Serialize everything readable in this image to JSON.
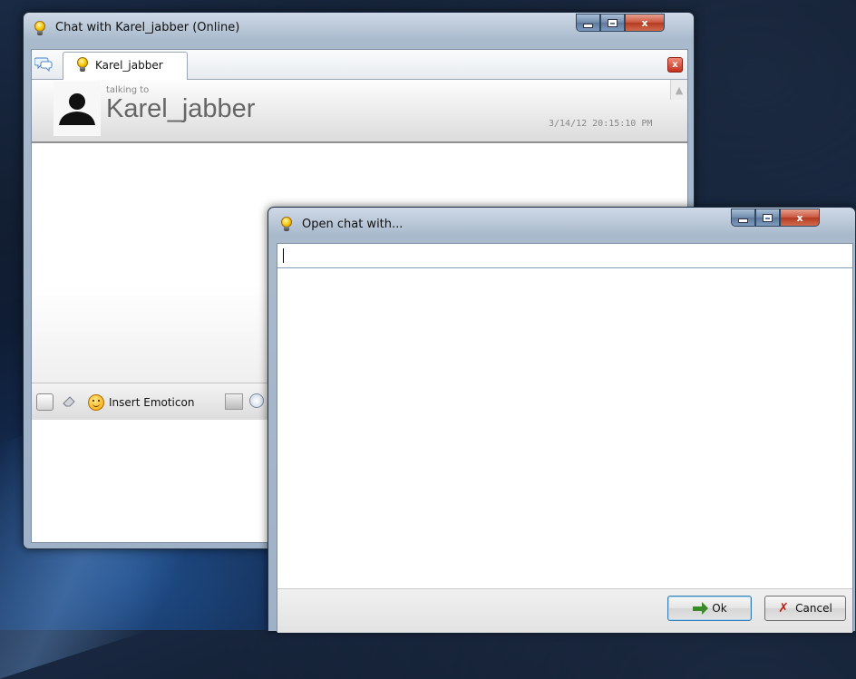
{
  "chat_window": {
    "title": "Chat with Karel_jabber (Online)",
    "tab_label": "Karel_jabber",
    "tab_close": "x",
    "talking_to": "talking to",
    "peer_name": "Karel_jabber",
    "timestamp": "3/14/12 20:15:10 PM",
    "toolbar": {
      "emoticon_label": "Insert Emoticon"
    },
    "caption_close": "x"
  },
  "dialog": {
    "title": "Open chat with...",
    "search_value": "",
    "ok_label": "Ok",
    "cancel_label": "Cancel",
    "caption_close": "x"
  },
  "colors": {
    "close_red": "#c9553e",
    "caption_blue": "#6f8aab",
    "ok_focus": "#3c7fb1"
  }
}
